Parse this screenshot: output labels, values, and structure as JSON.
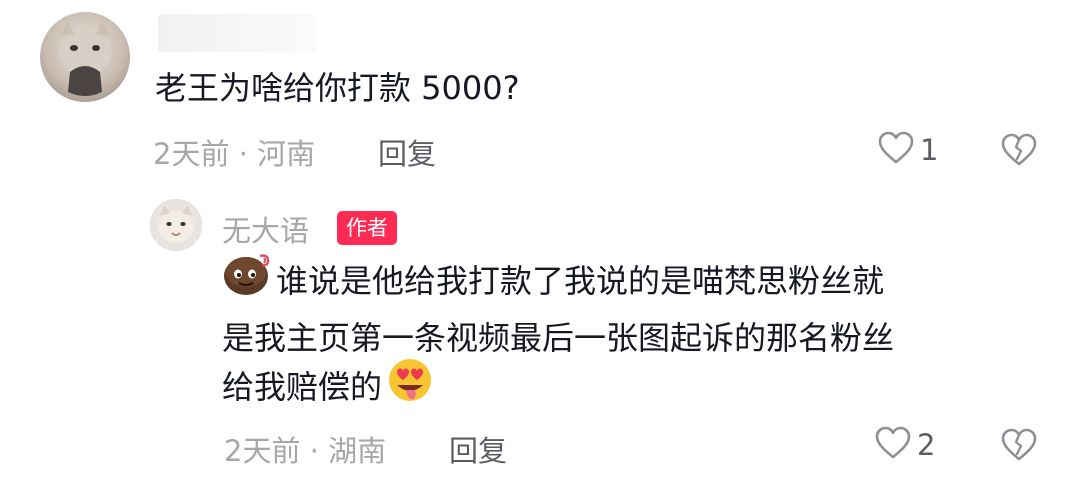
{
  "comment": {
    "text": "老王为啥给你打款 5000?",
    "meta": "2天前 · 河南",
    "reply_label": "回复",
    "like_count": "1"
  },
  "reply": {
    "author": "无大语",
    "author_badge": "作者",
    "lines": [
      "谁说是他给我打款了我说的是喵梵思粉丝就",
      "是我主页第一条视频最后一张图起诉的那名粉丝",
      "给我赔偿的"
    ],
    "meta": "2天前 · 湖南",
    "reply_label": "回复",
    "like_count": "2"
  },
  "icons": {
    "like": "heart-outline-icon",
    "dislike": "broken-heart-icon"
  },
  "colors": {
    "badge": "#fe2c55",
    "meta_text": "#a6a7ab",
    "reply_text": "#5c5d63"
  }
}
